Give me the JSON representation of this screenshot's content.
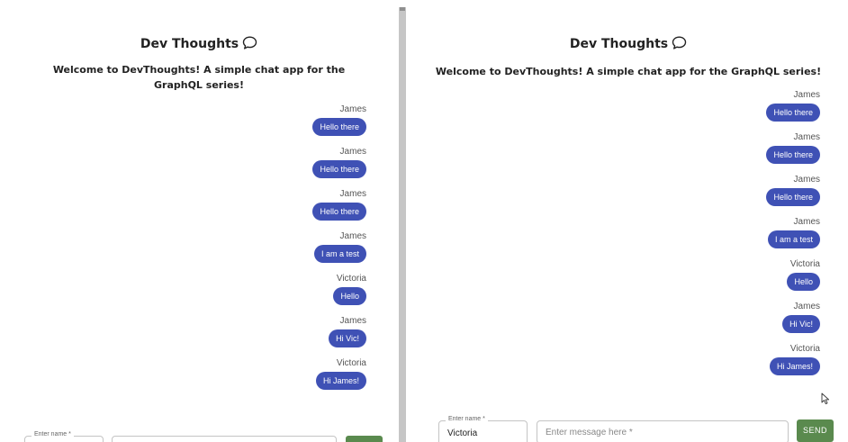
{
  "app": {
    "title": "Dev Thoughts",
    "welcome": "Welcome to DevThoughts! A simple chat app for the GraphQL series!"
  },
  "colors": {
    "bubble": "#3f51b5",
    "send_button": "#5a8a4e",
    "divider": "#c6c6c6"
  },
  "icons": {
    "title_icon": "chat-bubble-icon",
    "cursor": "mouse-pointer-icon"
  },
  "left": {
    "messages": [
      {
        "author": "James",
        "text": "Hello there"
      },
      {
        "author": "James",
        "text": "Hello there"
      },
      {
        "author": "James",
        "text": "Hello there"
      },
      {
        "author": "James",
        "text": "I am a test"
      },
      {
        "author": "Victoria",
        "text": "Hello"
      },
      {
        "author": "James",
        "text": "Hi Vic!"
      },
      {
        "author": "Victoria",
        "text": "Hi James!"
      }
    ],
    "name_label": "Enter name *",
    "name_value": "",
    "message_placeholder": "",
    "send_label": ""
  },
  "right": {
    "messages": [
      {
        "author": "James",
        "text": "Hello there"
      },
      {
        "author": "James",
        "text": "Hello there"
      },
      {
        "author": "James",
        "text": "Hello there"
      },
      {
        "author": "James",
        "text": "I am a test"
      },
      {
        "author": "Victoria",
        "text": "Hello"
      },
      {
        "author": "James",
        "text": "Hi Vic!"
      },
      {
        "author": "Victoria",
        "text": "Hi James!"
      }
    ],
    "name_label": "Enter name *",
    "name_value": "Victoria",
    "message_placeholder": "Enter message here *",
    "send_label": "SEND"
  }
}
